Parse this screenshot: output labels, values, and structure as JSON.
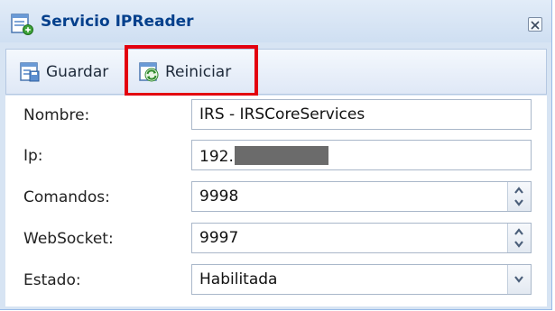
{
  "window": {
    "title": "Servicio IPReader"
  },
  "toolbar": {
    "save_label": "Guardar",
    "restart_label": "Reiniciar"
  },
  "form": {
    "nombre": {
      "label": "Nombre:",
      "value": "IRS - IRSCoreServices"
    },
    "ip": {
      "label": "Ip:",
      "value": "192."
    },
    "comandos": {
      "label": "Comandos:",
      "value": "9998"
    },
    "websocket": {
      "label": "WebSocket:",
      "value": "9997"
    },
    "estado": {
      "label": "Estado:",
      "value": "Habilitada"
    }
  },
  "icons": {
    "window": "form-window-icon",
    "save": "save-icon",
    "restart": "restart-icon",
    "close": "close-icon",
    "spinner": "spinner-up-down-icon",
    "dropdown": "chevron-down-icon"
  },
  "colors": {
    "title_text": "#04408c",
    "highlight": "#e3000f",
    "window_bg": "#d7e4f3"
  }
}
